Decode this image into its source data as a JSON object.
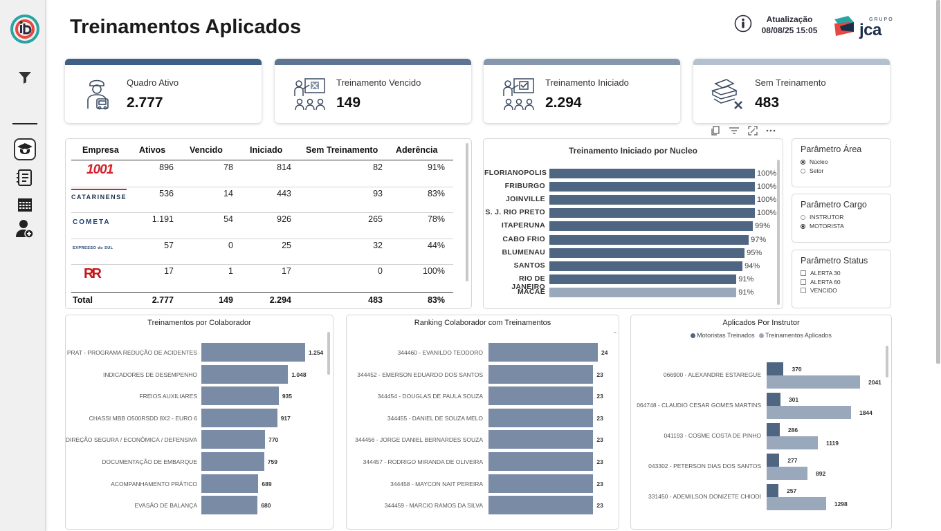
{
  "header": {
    "title": "Treinamentos Aplicados",
    "update_label": "Atualização",
    "update_date": "08/08/25 15:05",
    "brand_small": "GRUPO",
    "brand": "JCA"
  },
  "colors": {
    "dark_bar": "#4f6683",
    "light_bar": "#9aa8bc",
    "mid_bar": "#7a8ba6",
    "accent_red": "#e8473f",
    "accent_teal": "#2aa3a3"
  },
  "sidebar": {
    "items": [
      {
        "icon": "filter-icon"
      },
      {
        "icon": "graduation-cap-icon"
      },
      {
        "icon": "document-list-icon"
      },
      {
        "icon": "calendar-grid-icon"
      },
      {
        "icon": "user-add-icon"
      }
    ]
  },
  "kpis": [
    {
      "label": "Quadro Ativo",
      "value": "2.777",
      "icon": "driver-bus-icon",
      "color": "#3e5f86"
    },
    {
      "label": "Treinamento Vencido",
      "value": "149",
      "icon": "presentation-x-icon",
      "color": "#5d7592"
    },
    {
      "label": "Treinamento Iniciado",
      "value": "2.294",
      "icon": "presentation-check-icon",
      "color": "#8696ac"
    },
    {
      "label": "Sem Treinamento",
      "value": "483",
      "icon": "books-x-icon",
      "color": "#b4bfcf"
    }
  ],
  "table": {
    "headers": [
      "Empresa",
      "Ativos",
      "Vencido",
      "Iniciado",
      "Sem Treinamento",
      "Aderência"
    ],
    "rows": [
      {
        "empresa": "1001",
        "ativos": "896",
        "vencido": "78",
        "iniciado": "814",
        "sem": "82",
        "aderencia": "91%"
      },
      {
        "empresa": "CATARINENSE",
        "ativos": "536",
        "vencido": "14",
        "iniciado": "443",
        "sem": "93",
        "aderencia": "83%"
      },
      {
        "empresa": "COMETA",
        "ativos": "1.191",
        "vencido": "54",
        "iniciado": "926",
        "sem": "265",
        "aderencia": "78%"
      },
      {
        "empresa": "EXPRESSO do SUL",
        "ativos": "57",
        "vencido": "0",
        "iniciado": "25",
        "sem": "32",
        "aderencia": "44%"
      },
      {
        "empresa": "RR",
        "ativos": "17",
        "vencido": "1",
        "iniciado": "17",
        "sem": "0",
        "aderencia": "100%"
      }
    ],
    "total": {
      "label": "Total",
      "ativos": "2.777",
      "vencido": "149",
      "iniciado": "2.294",
      "sem": "483",
      "aderencia": "83%"
    }
  },
  "chart_data": [
    {
      "type": "bar",
      "title": "Treinamento Iniciado por Nucleo",
      "orientation": "horizontal",
      "categories": [
        "FLORIANOPOLIS",
        "FRIBURGO",
        "JOINVILLE",
        "S. J. RIO PRETO",
        "ITAPERUNA",
        "CABO FRIO",
        "BLUMENAU",
        "SANTOS",
        "RIO DE JANEIRO",
        "MACAE"
      ],
      "values": [
        100,
        100,
        100,
        100,
        99,
        97,
        95,
        94,
        91,
        91
      ],
      "value_labels": [
        "100%",
        "100%",
        "100%",
        "100%",
        "99%",
        "97%",
        "95%",
        "94%",
        "91%",
        "91%"
      ],
      "highlight_last": true
    },
    {
      "type": "bar",
      "title": "Treinamentos por Colaborador",
      "orientation": "horizontal",
      "categories": [
        "PRAT - PROGRAMA REDUÇÃO DE ACIDENTES",
        "INDICADORES DE DESEMPENHO",
        "FREIOS AUXILIARES",
        "CHASSI MBB O500RSDD 8X2 - EURO 6",
        "DIREÇÃO SEGURA / ECONÔMICA / DEFENSIVA",
        "DOCUMENTAÇÃO DE EMBARQUE",
        "ACOMPANHAMENTO PRÁTICO",
        "EVASÃO DE BALANÇA"
      ],
      "values": [
        1254,
        1048,
        935,
        917,
        770,
        759,
        689,
        680
      ],
      "value_labels": [
        "1.254",
        "1.048",
        "935",
        "917",
        "770",
        "759",
        "689",
        "680"
      ]
    },
    {
      "type": "bar",
      "title": "Ranking Colaborador com Treinamentos",
      "orientation": "horizontal",
      "categories": [
        "344460 - EVANILDO TEODORO",
        "344452 - EMERSON EDUARDO DOS SANTOS",
        "344454 - DOUGLAS DE PAULA SOUZA",
        "344455 - DANIEL DE SOUZA MELO",
        "344456 - JORGE DANIEL BERNARDES SOUZA",
        "344457 - RODRIGO MIRANDA DE OLIVEIRA",
        "344458 - MAYCON NAIT PEREIRA",
        "344459 - MARCIO RAMOS DA SILVA"
      ],
      "values": [
        24,
        23,
        23,
        23,
        23,
        23,
        23,
        23
      ]
    },
    {
      "type": "bar",
      "title": "Aplicados Por Instrutor",
      "orientation": "horizontal",
      "categories": [
        "066900 - ALEXANDRE ESTAREGUE",
        "064748 - CLAUDIO CESAR GOMES MARTINS",
        "041193 - COSME COSTA DE PINHO",
        "043302 - PETERSON DIAS DOS SANTOS",
        "331450 - ADEMILSON DONIZETE CHIODI"
      ],
      "series": [
        {
          "name": "Motoristas Treinados",
          "values": [
            370,
            301,
            286,
            277,
            257
          ],
          "color": "#4f6683"
        },
        {
          "name": "Treinamentos Aplicados",
          "values": [
            2041,
            1844,
            1119,
            892,
            1298
          ],
          "color": "#9aa8bc"
        }
      ],
      "legend": "top-center"
    }
  ],
  "slicers": {
    "area": {
      "title": "Parâmetro Área",
      "options": [
        "Núcleo",
        "Setor"
      ],
      "selected": "Núcleo"
    },
    "cargo": {
      "title": "Parâmetro Cargo",
      "options": [
        "INSTRUTOR",
        "MOTORISTA"
      ],
      "selected": "MOTORISTA"
    },
    "status": {
      "title": "Parâmetro Status",
      "options": [
        "ALERTA 30",
        "ALERTA 60",
        "VENCIDO"
      ]
    }
  }
}
